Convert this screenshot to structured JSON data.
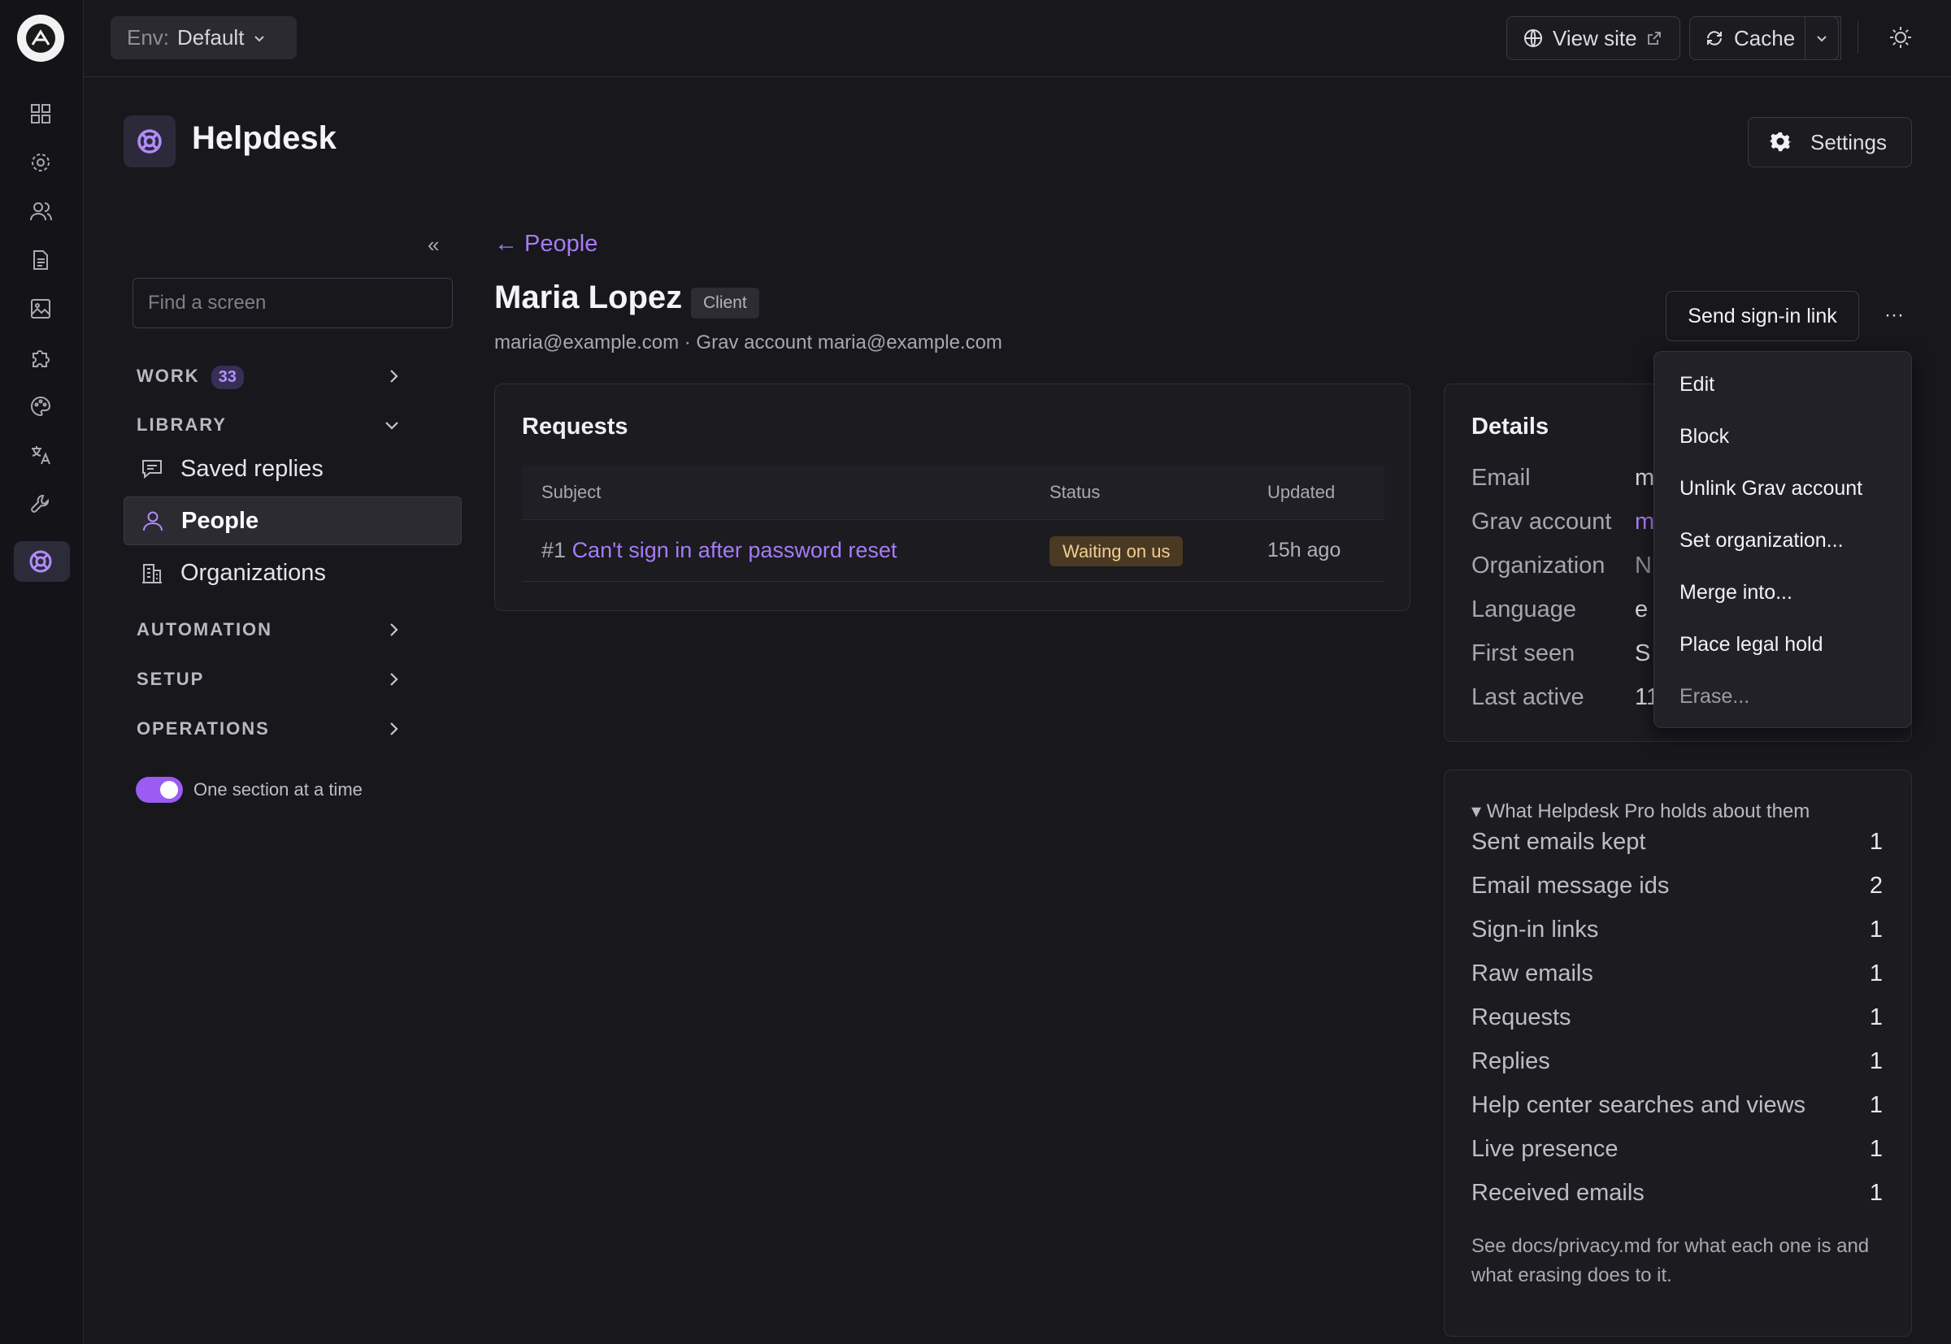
{
  "topbar": {
    "env_label": "Env:",
    "env_value": "Default",
    "view_site": "View site",
    "cache": "Cache"
  },
  "app": {
    "title": "Helpdesk",
    "settings_label": "Settings"
  },
  "sidebar": {
    "search_placeholder": "Find a screen",
    "work": {
      "label": "WORK",
      "count": "33"
    },
    "library": {
      "label": "LIBRARY",
      "items": [
        {
          "label": "Saved replies",
          "icon": "chat-bubble-icon"
        },
        {
          "label": "People",
          "icon": "person-icon",
          "active": true
        },
        {
          "label": "Organizations",
          "icon": "building-icon"
        }
      ]
    },
    "automation": "AUTOMATION",
    "setup": "SETUP",
    "operations": "OPERATIONS",
    "toggle_label": "One section at a time",
    "toggle_on": true
  },
  "person": {
    "back_link": "← People",
    "name": "Maria Lopez",
    "tag": "Client",
    "meta": "maria@example.com · Grav account maria@example.com",
    "send_link_button": "Send sign-in link",
    "more_button": "···"
  },
  "requests": {
    "title": "Requests",
    "columns": [
      "Subject",
      "Status",
      "Updated"
    ],
    "rows": [
      {
        "id": "#1",
        "subject": "Can't sign in after password reset",
        "status": "Waiting on us",
        "updated": "15h ago"
      }
    ]
  },
  "details": {
    "title": "Details",
    "rows": [
      {
        "label": "Email",
        "value": "m"
      },
      {
        "label": "Grav account",
        "value": "m"
      },
      {
        "label": "Organization",
        "value": "N"
      },
      {
        "label": "Language",
        "value": "e"
      },
      {
        "label": "First seen",
        "value": "S"
      },
      {
        "label": "Last active",
        "value": "11"
      }
    ]
  },
  "menu": {
    "items": [
      "Edit",
      "Block",
      "Unlink Grav account",
      "Set organization...",
      "Merge into...",
      "Place legal hold",
      "Erase..."
    ]
  },
  "holdings": {
    "summary": "▾ What Helpdesk Pro holds about them",
    "rows": [
      {
        "label": "Sent emails kept",
        "count": "1"
      },
      {
        "label": "Email message ids",
        "count": "2"
      },
      {
        "label": "Sign-in links",
        "count": "1"
      },
      {
        "label": "Raw emails",
        "count": "1"
      },
      {
        "label": "Requests",
        "count": "1"
      },
      {
        "label": "Replies",
        "count": "1"
      },
      {
        "label": "Help center searches and views",
        "count": "1"
      },
      {
        "label": "Live presence",
        "count": "1"
      },
      {
        "label": "Received emails",
        "count": "1"
      }
    ],
    "footnote": "See docs/privacy.md for what each one is and what erasing does to it."
  },
  "colors": {
    "accent": "#a77bf5",
    "background": "#17171c",
    "status_waiting": "#4a3a24"
  }
}
